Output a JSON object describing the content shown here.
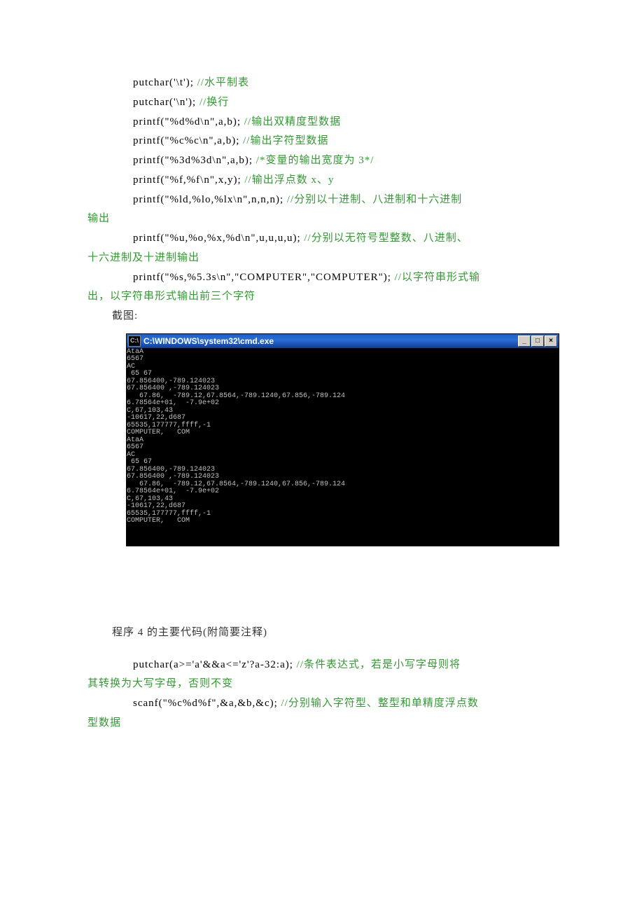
{
  "lines": [
    {
      "indent": "indent1",
      "black": "putchar('\\t'); ",
      "green": "//水平制表"
    },
    {
      "indent": "indent1",
      "black": "putchar('\\n'); ",
      "green": "//换行"
    },
    {
      "indent": "indent1",
      "black": "printf(\"%d%d\\n\",a,b); ",
      "green": "//输出双精度型数据"
    },
    {
      "indent": "indent1",
      "black": "printf(\"%c%c\\n\",a,b); ",
      "green": "//输出字符型数据"
    },
    {
      "indent": "indent1",
      "black": "printf(\"%3d%3d\\n\",a,b); ",
      "green": "/*变量的输出宽度为 3*/"
    },
    {
      "indent": "indent1",
      "black": "printf(\"%f,%f\\n\",x,y); ",
      "green": "//输出浮点数 x、y"
    },
    {
      "indent": "indent1",
      "black": "printf(\"%ld,%lo,%lx\\n\",n,n,n); ",
      "green": "//分别以十进制、八进制和十六进制"
    },
    {
      "indent": "",
      "black": "",
      "green": "输出"
    },
    {
      "indent": "indent1",
      "black": "printf(\"%u,%o,%x,%d\\n\",u,u,u,u); ",
      "green": "//分别以无符号型整数、八进制、"
    },
    {
      "indent": "",
      "black": "",
      "green": "十六进制及十进制输出"
    },
    {
      "indent": "indent1",
      "black": "printf(\"%s,%5.3s\\n\",\"COMPUTER\",\"COMPUTER\"); ",
      "green": "//以字符串形式输"
    },
    {
      "indent": "",
      "black": "",
      "green": "出，以字符串形式输出前三个字符"
    }
  ],
  "screenshot_label": "截图:",
  "terminal": {
    "title": "C:\\WINDOWS\\system32\\cmd.exe",
    "icon": "C:\\",
    "btn_min": "_",
    "btn_max": "□",
    "btn_close": "×",
    "output": "AtaA\n6567\nAC\n 65 67\n67.856400,-789.124023\n67.856400 ,-789.124023\n   67.86,  -789.12,67.8564,-789.1240,67.856,-789.124\n6.78564e+01,  -7.9e+02\nC,67,103,43\n-10617,22,d687\n65535,177777,ffff,-1\nCOMPUTER,   COM\nAtaA\n6567\nAC\n 65 67\n67.856400,-789.124023\n67.856400 ,-789.124023\n   67.86,  -789.12,67.8564,-789.1240,67.856,-789.124\n6.78564e+01,  -7.9e+02\nC,67,103,43\n-10617,22,d687\n65535,177777,ffff,-1\nCOMPUTER,   COM"
  },
  "section_label": "程序 4 的主要代码(附简要注释)",
  "lines2": [
    {
      "indent": "indent1",
      "black": "putchar(a>='a'&&a<='z'?a-32:a); ",
      "green": "//条件表达式，若是小写字母则将"
    },
    {
      "indent": "",
      "black": "",
      "green": "其转换为大写字母，否则不变"
    },
    {
      "indent": "indent1",
      "black": "scanf(\"%c%d%f\",&a,&b,&c); ",
      "green": "//分别输入字符型、整型和单精度浮点数"
    },
    {
      "indent": "",
      "black": "",
      "green": "型数据"
    }
  ]
}
